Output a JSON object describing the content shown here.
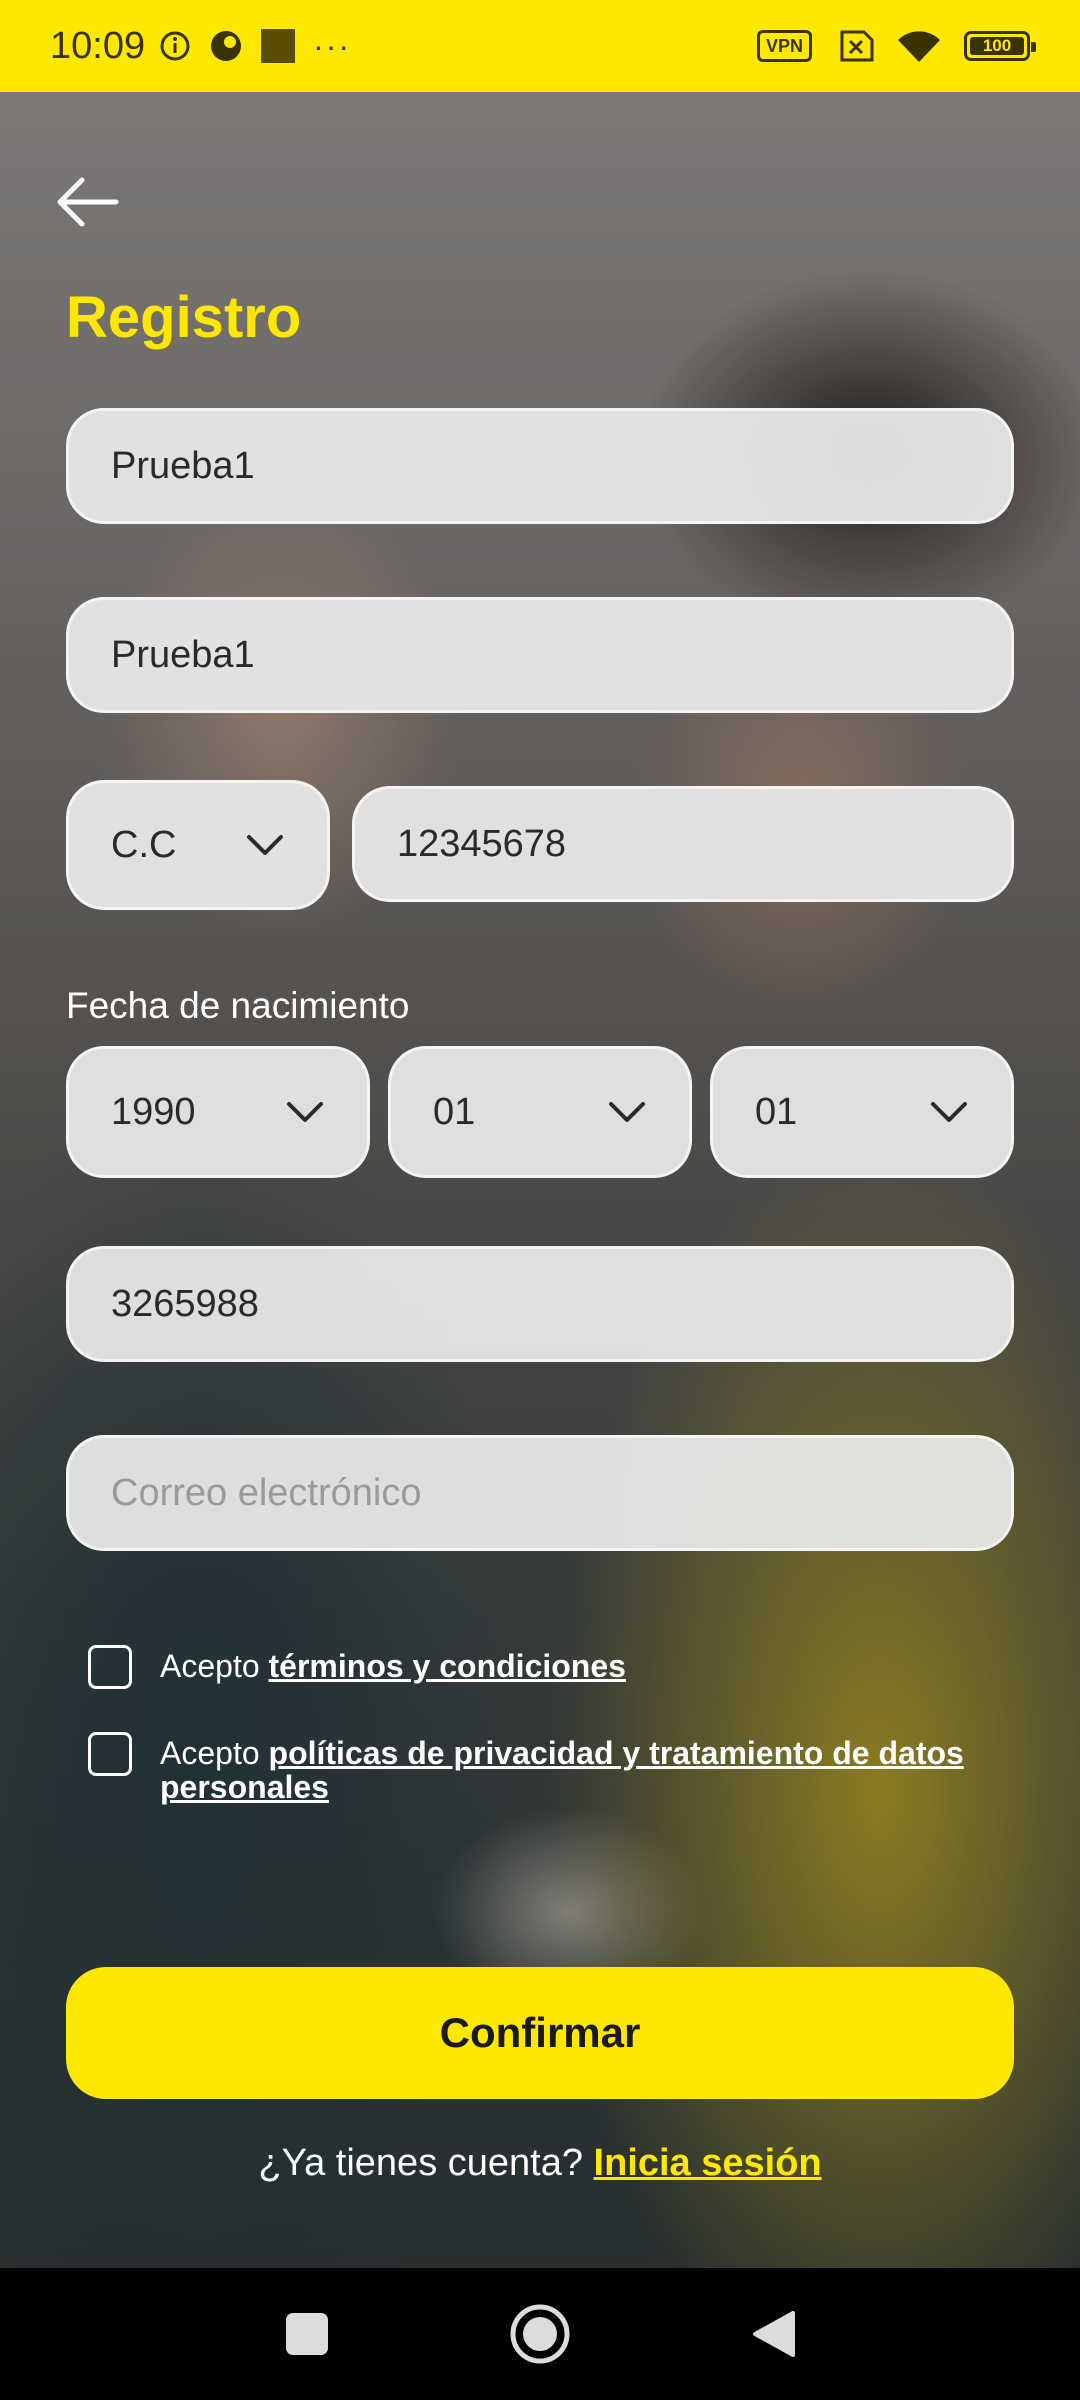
{
  "status_bar": {
    "time": "10:09",
    "vpn_label": "VPN",
    "battery": "100",
    "more_indicator": "···",
    "icons": [
      "info-icon",
      "app-icon",
      "square-icon",
      "vpn-icon",
      "no-sim-icon",
      "wifi-icon",
      "battery-icon"
    ]
  },
  "header": {
    "back_icon": "arrow-left-icon",
    "title": "Registro"
  },
  "form": {
    "first_name": "Prueba1",
    "last_name": "Prueba1",
    "doc_type": "C.C",
    "doc_number": "12345678",
    "birth_label": "Fecha de nacimiento",
    "birth_year": "1990",
    "birth_month": "01",
    "birth_day": "01",
    "phone": "3265988",
    "email_placeholder": "Correo electrónico",
    "email_value": ""
  },
  "consents": {
    "terms_prefix": "Acepto ",
    "terms_link": "términos y condiciones",
    "terms_checked": false,
    "privacy_prefix": "Acepto ",
    "privacy_link": "políticas de privacidad y tratamiento de datos personales",
    "privacy_checked": false
  },
  "actions": {
    "confirm_label": "Confirmar",
    "login_prompt": "¿Ya tienes cuenta? ",
    "login_link": "Inicia sesión"
  },
  "colors": {
    "accent": "#ffe800",
    "field_bg": "#ebebeb",
    "text_dark": "#2a2a2a"
  },
  "nav_bar": {
    "icons": [
      "recents-square-icon",
      "home-circle-icon",
      "back-triangle-icon"
    ]
  }
}
